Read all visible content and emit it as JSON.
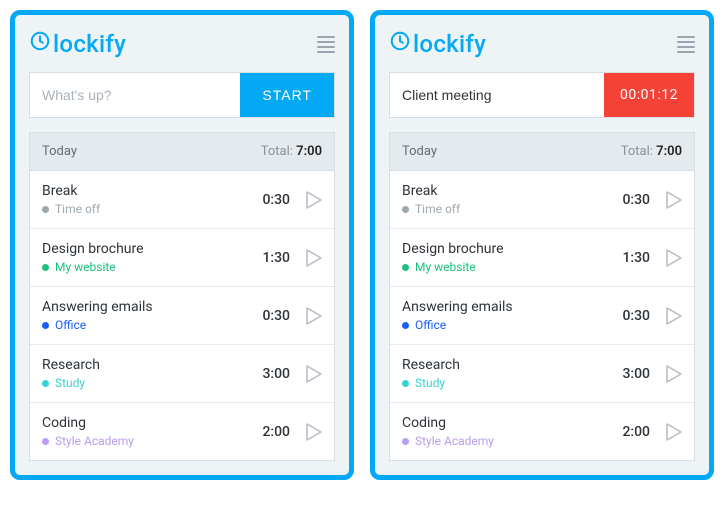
{
  "brand": "lockify",
  "panels": [
    {
      "input": {
        "placeholder": "What's up?",
        "value": ""
      },
      "action": {
        "type": "start",
        "label": "START"
      }
    },
    {
      "input": {
        "placeholder": "What's up?",
        "value": "Client meeting"
      },
      "action": {
        "type": "timer",
        "label": "00:01:12"
      }
    }
  ],
  "day": {
    "label": "Today",
    "total_label": "Total:",
    "total_value": "7:00"
  },
  "entries": [
    {
      "title": "Break",
      "project": "Time off",
      "color": "#9ea7af",
      "duration": "0:30"
    },
    {
      "title": "Design brochure",
      "project": "My website",
      "color": "#1ec07f",
      "duration": "1:30"
    },
    {
      "title": "Answering emails",
      "project": "Office",
      "color": "#1a5cff",
      "duration": "0:30"
    },
    {
      "title": "Research",
      "project": "Study",
      "color": "#31d4d4",
      "duration": "3:00"
    },
    {
      "title": "Coding",
      "project": "Style Academy",
      "color": "#b89cf0",
      "duration": "2:00"
    }
  ]
}
